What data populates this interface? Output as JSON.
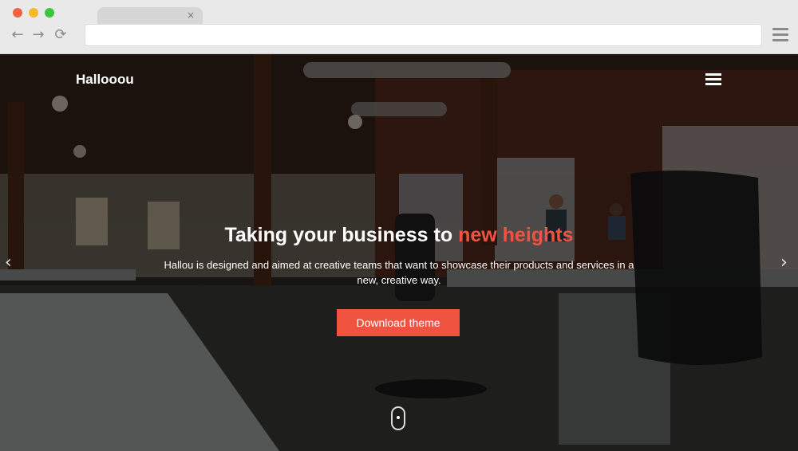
{
  "browser": {
    "tab_close": "×",
    "back": "←",
    "forward": "→",
    "reload": "⟳",
    "address_value": ""
  },
  "site": {
    "brand": "Hallooou",
    "hero": {
      "title_main": "Taking your business to ",
      "title_accent": "new heights",
      "subtitle": "Hallou is designed and aimed at creative teams that want to showcase their products and services in a new, creative way.",
      "cta_label": "Download theme",
      "prev_arrow": "‹",
      "next_arrow": "›"
    }
  },
  "colors": {
    "accent": "#f0533f",
    "chrome": "#e9e9e9"
  },
  "icons": [
    "close-icon",
    "back-arrow-icon",
    "forward-arrow-icon",
    "reload-icon",
    "browser-menu-icon",
    "hamburger-menu-icon",
    "chevron-left-icon",
    "chevron-right-icon",
    "mouse-scroll-icon"
  ]
}
